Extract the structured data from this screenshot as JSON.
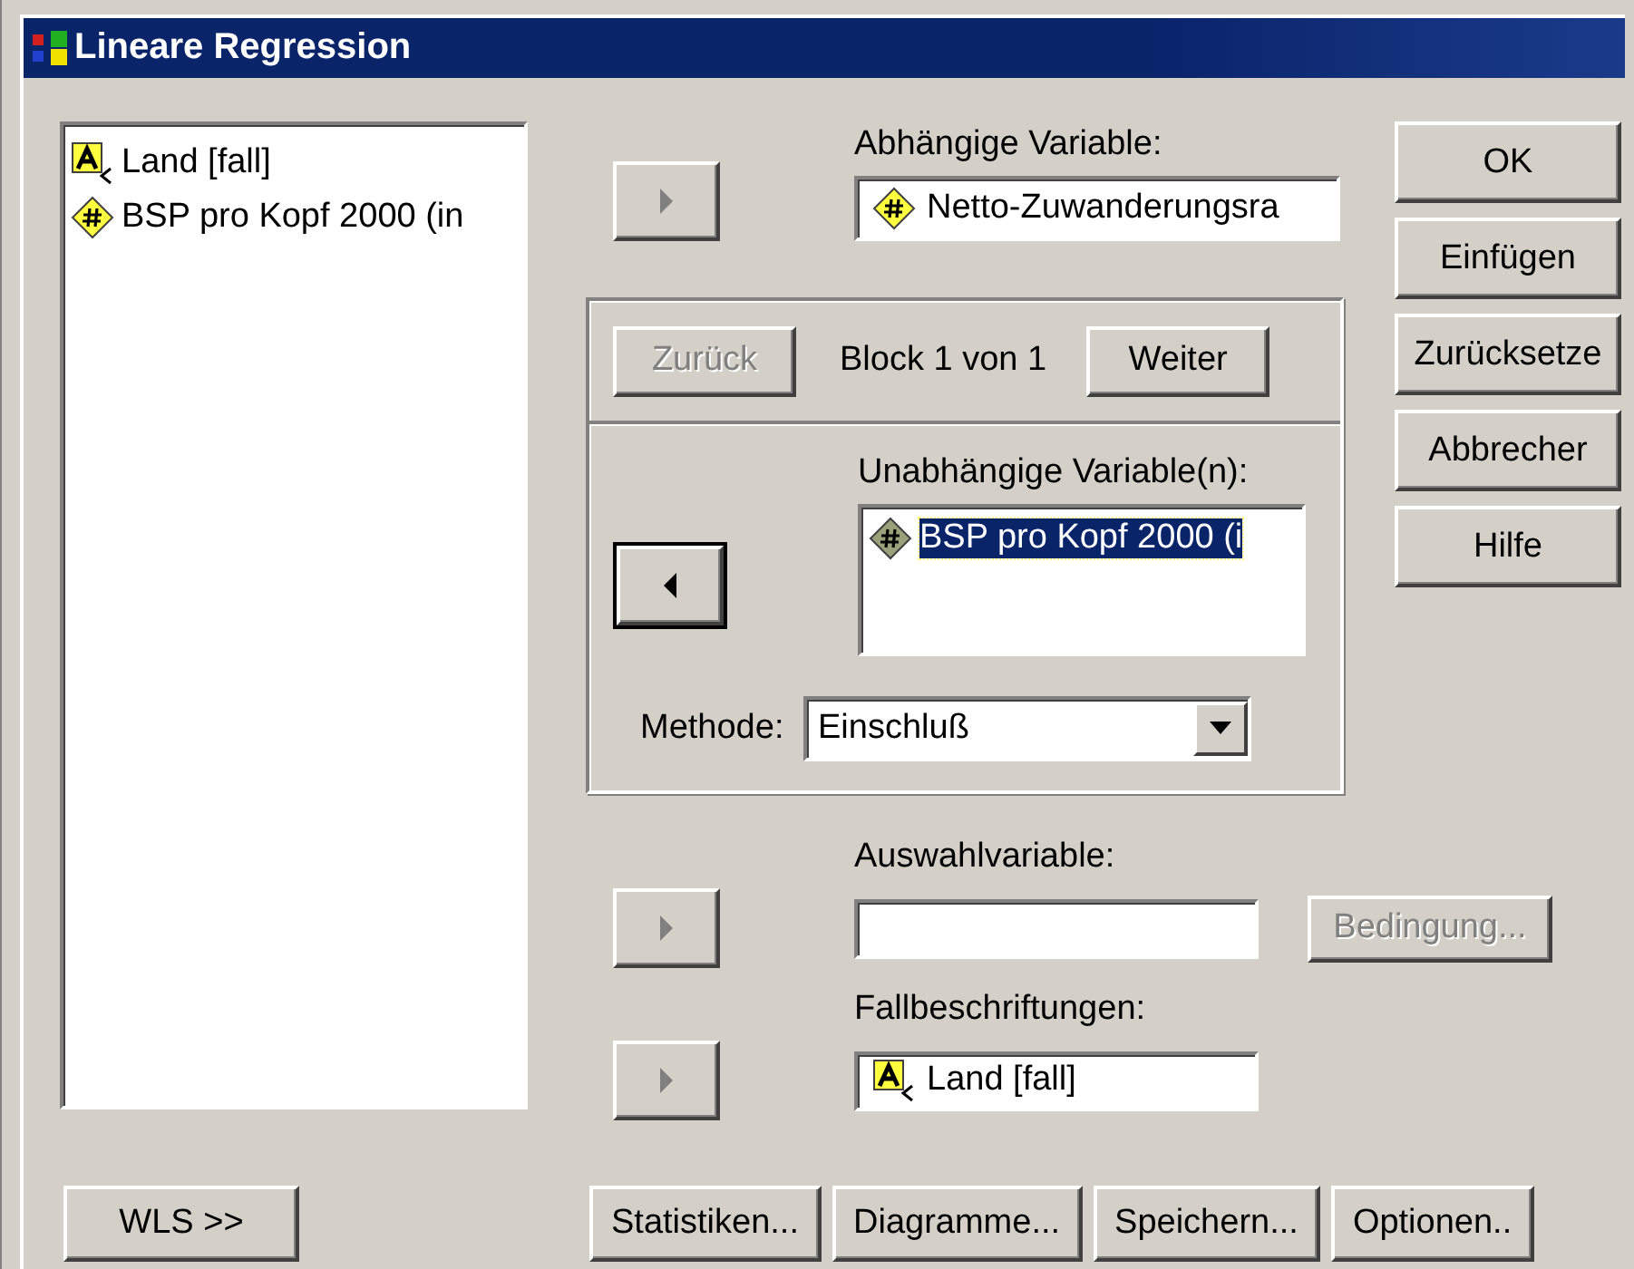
{
  "window": {
    "title": "Lineare Regression"
  },
  "source_list": {
    "items": [
      {
        "name": "Land [fall]",
        "kind": "string",
        "selected": false
      },
      {
        "name": "BSP pro Kopf 2000 (in",
        "kind": "scale",
        "selected": false
      }
    ]
  },
  "dependent": {
    "mover": {
      "kind": "right",
      "disabled": true,
      "default": false
    },
    "label": "Abhängige Variable:",
    "value": {
      "name": "Netto-Zuwanderungsra",
      "kind": "scale"
    }
  },
  "block": {
    "previous": {
      "label": "Zurück",
      "disabled": true
    },
    "caption": "Block 1 von 1",
    "next": {
      "label": "Weiter",
      "disabled": false
    },
    "mover": {
      "kind": "left",
      "disabled": false,
      "default": true
    },
    "label": "Unabhängige Variable(n):",
    "items": [
      {
        "name": "BSP pro Kopf 2000 (i",
        "kind": "scale",
        "selected": true
      }
    ],
    "method": {
      "label": "Methode:",
      "value": "Einschluß"
    }
  },
  "selection": {
    "mover": {
      "kind": "right",
      "disabled": true,
      "default": false
    },
    "label": "Auswahlvariable:",
    "condition": {
      "label": "Bedingung...",
      "disabled": true
    }
  },
  "case_labels": {
    "mover": {
      "kind": "right",
      "disabled": true,
      "default": false
    },
    "label": "Fallbeschriftungen:",
    "value": {
      "name": "Land [fall]",
      "kind": "string"
    }
  },
  "side_buttons": [
    {
      "label": "OK"
    },
    {
      "label": "Einfügen"
    },
    {
      "label": "Zurücksetze"
    },
    {
      "label": "Abbrecher"
    },
    {
      "label": "Hilfe"
    }
  ],
  "wls_button": {
    "label": "WLS >>"
  },
  "bottom_buttons": [
    {
      "label": "Statistiken..."
    },
    {
      "label": "Diagramme..."
    },
    {
      "label": "Speichern..."
    },
    {
      "label": "Optionen.."
    }
  ]
}
